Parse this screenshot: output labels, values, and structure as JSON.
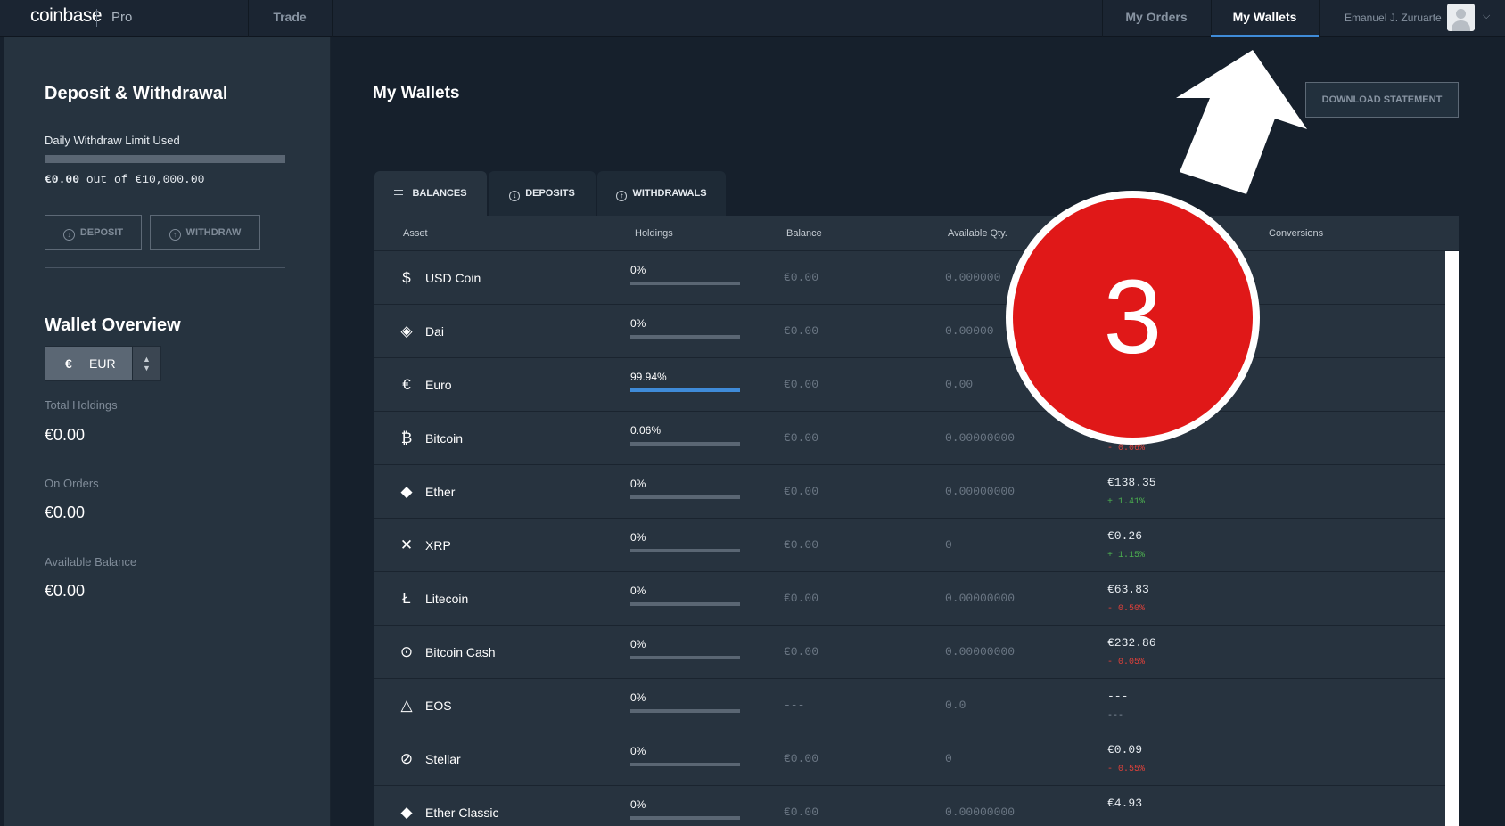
{
  "topbar": {
    "logo": "coinbase",
    "logo_suffix": "Pro",
    "nav_trade": "Trade",
    "nav_orders": "My Orders",
    "nav_wallets": "My Wallets",
    "user_name": "Emanuel J. Zuruarte",
    "avatar_icon": "user-avatar-icon",
    "caret_icon": "chevron-down-icon"
  },
  "sidebar": {
    "title": "Deposit & Withdrawal",
    "limit_label": "Daily Withdraw Limit Used",
    "limit_used_fraction": 0,
    "limit_used": "€0.00",
    "limit_out_of": " out of €10,000.00",
    "deposit_label": "DEPOSIT",
    "withdraw_label": "WITHDRAW",
    "overview_title": "Wallet Overview",
    "currency_symbol": "€",
    "currency_code": "EUR",
    "total_holdings_label": "Total Holdings",
    "total_holdings_value": "€0.00",
    "on_orders_label": "On Orders",
    "on_orders_value": "€0.00",
    "available_label": "Available Balance",
    "available_value": "€0.00"
  },
  "main": {
    "title": "My Wallets",
    "download_label": "DOWNLOAD STATEMENT",
    "tabs": [
      {
        "label": "BALANCES",
        "icon": "list-icon"
      },
      {
        "label": "DEPOSITS",
        "icon": "arrow-down-circle-icon"
      },
      {
        "label": "WITHDRAWALS",
        "icon": "arrow-up-circle-icon"
      }
    ],
    "columns": [
      "Asset",
      "Holdings",
      "Balance",
      "Available Qty.",
      "Conversions"
    ],
    "rows": [
      {
        "asset": "USD Coin",
        "icon": "usdc-icon",
        "glyph": "$",
        "holdings": "0%",
        "holdings_fraction": 0,
        "balance": "€0.00",
        "available": "0.000000",
        "conversion": "",
        "change": "",
        "change_dir": "neutral"
      },
      {
        "asset": "Dai",
        "icon": "dai-icon",
        "glyph": "◈",
        "holdings": "0%",
        "holdings_fraction": 0,
        "balance": "€0.00",
        "available": "0.00000",
        "conversion": "",
        "change": "",
        "change_dir": "neutral"
      },
      {
        "asset": "Euro",
        "icon": "euro-icon",
        "glyph": "€",
        "holdings": "99.94%",
        "holdings_fraction": 0.9994,
        "balance": "€0.00",
        "available": "0.00",
        "conversion": "",
        "change": "",
        "change_dir": "neutral"
      },
      {
        "asset": "Bitcoin",
        "icon": "bitcoin-icon",
        "glyph": "₿",
        "holdings": "0.06%",
        "holdings_fraction": 0.0006,
        "balance": "€0.00",
        "available": "0.00000000",
        "conversion": "",
        "change": "- 0.06%",
        "change_dir": "down"
      },
      {
        "asset": "Ether",
        "icon": "ether-icon",
        "glyph": "◆",
        "holdings": "0%",
        "holdings_fraction": 0,
        "balance": "€0.00",
        "available": "0.00000000",
        "conversion": "€138.35",
        "change": "+ 1.41%",
        "change_dir": "up"
      },
      {
        "asset": "XRP",
        "icon": "xrp-icon",
        "glyph": "✕",
        "holdings": "0%",
        "holdings_fraction": 0,
        "balance": "€0.00",
        "available": "0",
        "conversion": "€0.26",
        "change": "+ 1.15%",
        "change_dir": "up"
      },
      {
        "asset": "Litecoin",
        "icon": "litecoin-icon",
        "glyph": "Ł",
        "holdings": "0%",
        "holdings_fraction": 0,
        "balance": "€0.00",
        "available": "0.00000000",
        "conversion": "€63.83",
        "change": "- 0.50%",
        "change_dir": "down"
      },
      {
        "asset": "Bitcoin Cash",
        "icon": "bitcoin-cash-icon",
        "glyph": "⊙",
        "holdings": "0%",
        "holdings_fraction": 0,
        "balance": "€0.00",
        "available": "0.00000000",
        "conversion": "€232.86",
        "change": "- 0.05%",
        "change_dir": "down"
      },
      {
        "asset": "EOS",
        "icon": "eos-icon",
        "glyph": "△",
        "holdings": "0%",
        "holdings_fraction": 0,
        "balance": "---",
        "available": "0.0",
        "conversion": "---",
        "change": "---",
        "change_dir": "neutral"
      },
      {
        "asset": "Stellar",
        "icon": "stellar-icon",
        "glyph": "⊘",
        "holdings": "0%",
        "holdings_fraction": 0,
        "balance": "€0.00",
        "available": "0",
        "conversion": "€0.09",
        "change": "- 0.55%",
        "change_dir": "down"
      },
      {
        "asset": "Ether Classic",
        "icon": "ether-classic-icon",
        "glyph": "◆",
        "holdings": "0%",
        "holdings_fraction": 0,
        "balance": "€0.00",
        "available": "0.00000000",
        "conversion": "€4.93",
        "change": "",
        "change_dir": "neutral"
      }
    ]
  },
  "overlay": {
    "step_number": "3",
    "arrow_icon": "pointer-arrow-icon",
    "badge_color": "#e01818",
    "accent_color": "#3f8bd8"
  }
}
